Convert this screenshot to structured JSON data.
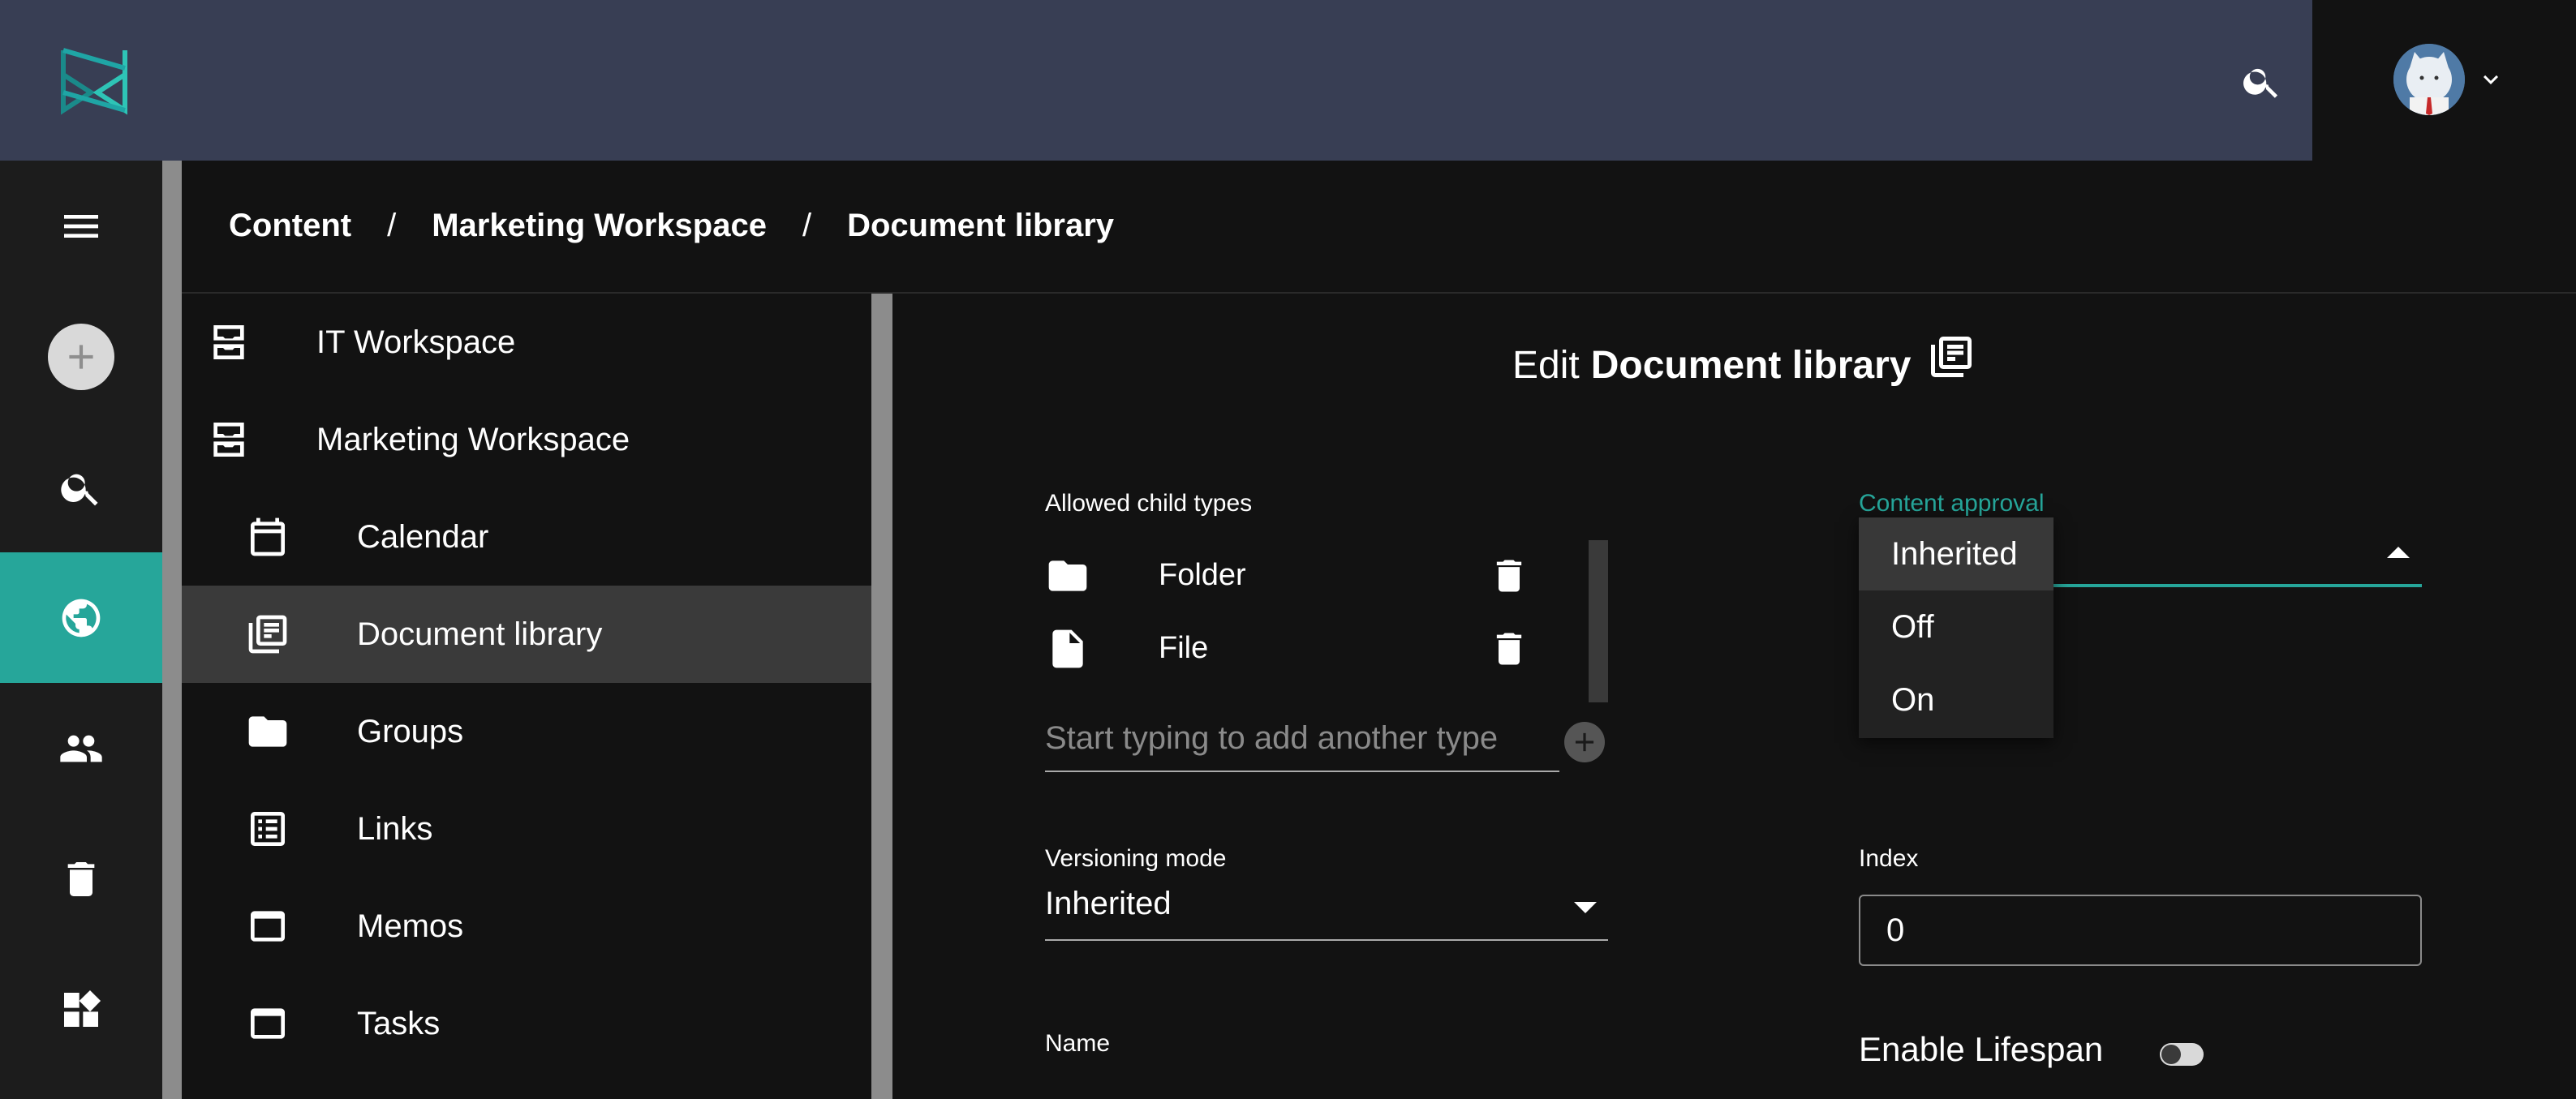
{
  "topbar": {
    "logo_icon": "brand-logo-icon",
    "search_icon": "search-icon",
    "account_icon": "chevron-down-icon"
  },
  "rail": {
    "items": [
      {
        "icon": "menu-icon"
      },
      {
        "icon": "add-icon"
      },
      {
        "icon": "search-icon"
      },
      {
        "icon": "globe-icon",
        "active": true
      },
      {
        "icon": "users-icon"
      },
      {
        "icon": "trash-icon"
      },
      {
        "icon": "widgets-icon"
      }
    ],
    "active_color": "#26a69a"
  },
  "breadcrumb": {
    "items": [
      "Content",
      "Marketing Workspace",
      "Document library"
    ],
    "separator": "/"
  },
  "tree": {
    "items": [
      {
        "label": "IT Workspace",
        "icon": "workspace-icon"
      },
      {
        "label": "Marketing Workspace",
        "icon": "workspace-icon"
      },
      {
        "label": "Calendar",
        "icon": "calendar-icon"
      },
      {
        "label": "Document library",
        "icon": "document-library-icon",
        "selected": true
      },
      {
        "label": "Groups",
        "icon": "folder-icon"
      },
      {
        "label": "Links",
        "icon": "list-icon"
      },
      {
        "label": "Memos",
        "icon": "window-icon"
      },
      {
        "label": "Tasks",
        "icon": "window-icon"
      }
    ]
  },
  "edit": {
    "title_prefix": "Edit",
    "title_name": "Document library",
    "allowed_child_types": {
      "label": "Allowed child types",
      "items": [
        {
          "label": "Folder",
          "icon": "folder-icon"
        },
        {
          "label": "File",
          "icon": "file-icon"
        }
      ],
      "input_placeholder": "Start typing to add another type"
    },
    "content_approval": {
      "label": "Content approval",
      "options": [
        "Inherited",
        "Off",
        "On"
      ],
      "selected": "Inherited"
    },
    "versioning_mode": {
      "label": "Versioning mode",
      "value": "Inherited"
    },
    "index": {
      "label": "Index",
      "value": "0"
    },
    "name": {
      "label": "Name"
    },
    "lifespan": {
      "label": "Enable Lifespan",
      "enabled": false
    }
  }
}
